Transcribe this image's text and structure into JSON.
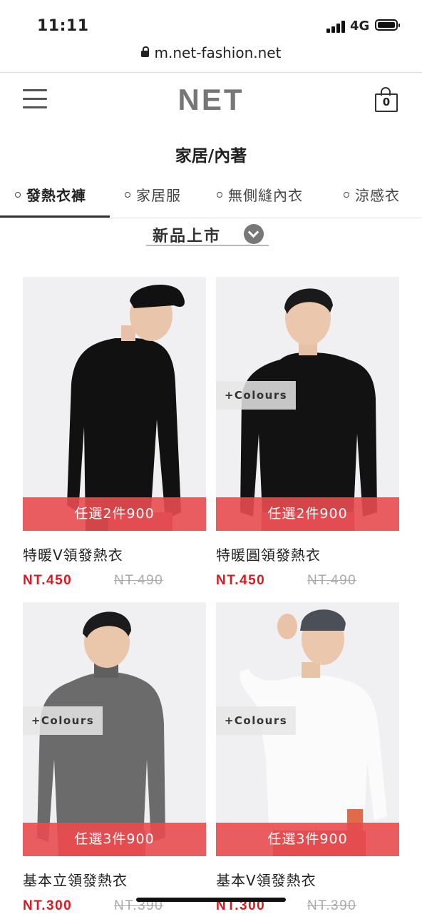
{
  "status_bar": {
    "time": "11:11",
    "network": "4G"
  },
  "url_bar": {
    "url": "m.net-fashion.net"
  },
  "header": {
    "logo": "NET",
    "cart_count": "0"
  },
  "category": {
    "title": "家居/內著",
    "tabs": [
      {
        "label": "發熱衣褲",
        "active": true
      },
      {
        "label": "家居服",
        "active": false
      },
      {
        "label": "無側縫內衣",
        "active": false
      },
      {
        "label": "涼感衣",
        "active": false
      }
    ]
  },
  "sort": {
    "label": "新品上市"
  },
  "products": [
    {
      "name": "特暖V領發熱衣",
      "price": "NT.450",
      "old_price": "NT.490",
      "promo": "任選2件900",
      "colours": ""
    },
    {
      "name": "特暖圓領發熱衣",
      "price": "NT.450",
      "old_price": "NT.490",
      "promo": "任選2件900",
      "colours": "+Colours"
    },
    {
      "name": "基本立領發熱衣",
      "price": "NT.300",
      "old_price": "NT.390",
      "promo": "任選3件900",
      "colours": "+Colours"
    },
    {
      "name": "基本V領發熱衣",
      "price": "NT.300",
      "old_price": "NT.390",
      "promo": "任選3件900",
      "colours": "+Colours"
    }
  ],
  "colors": {
    "price": "#d71920",
    "promo_bg": "#e84c50",
    "logo": "#777777"
  }
}
